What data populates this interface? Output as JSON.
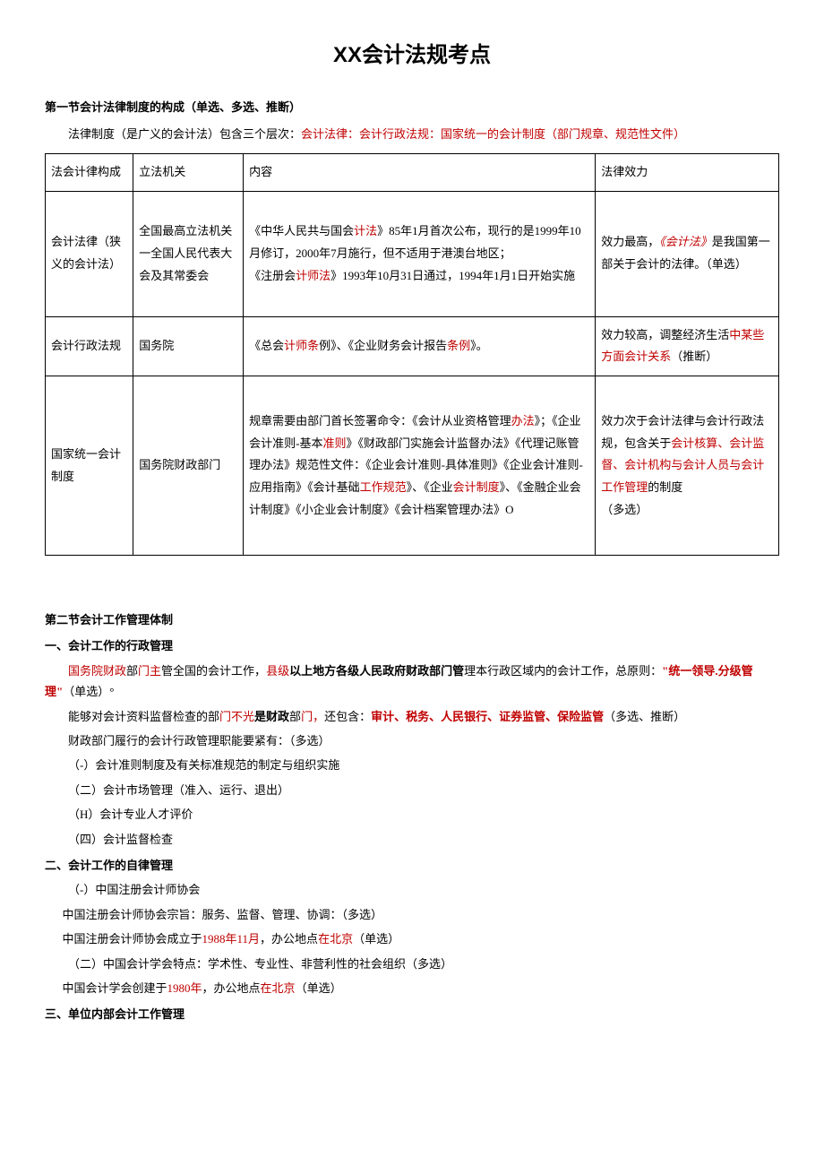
{
  "title": "XX会计法规考点",
  "section1": {
    "heading": "第一节会计法律制度的构成（单选、多选、推断）",
    "intro_pre": "法律制度（是广义的会计法）包含三个层次：",
    "intro_red": "会计法律：会计行政法规：国家统一的会计制度（部门规章、规范性文件）"
  },
  "table": {
    "header": {
      "c1": "法会计律构成",
      "c2": "立法机关",
      "c3": "内容",
      "c4": "法律效力"
    },
    "row1": {
      "c1": "会计法律（狭义的会计法）",
      "c2_a": "全国最高立法机关",
      "c2_b": "一全国人民代表大会及其常委会",
      "c3_a": "《中华人民共与国会",
      "c3_a_red": "计法",
      "c3_a2": "》85年1月首次公布，现行的是1999年10月修订，2000年7月施行，但不适用于港澳台地区；",
      "c3_b": "《注册会",
      "c3_b_red": "计师法",
      "c3_b2": "》1993年10月31日通过，1994年1月1日开始实施",
      "c4_a": "效力最高，",
      "c4_red": "《会计法》",
      "c4_b": "是我国第一部关于会计的法律。（单选）"
    },
    "row2": {
      "c1": "会计行政法规",
      "c2": "国务院",
      "c3_a": "《总会",
      "c3_a_red": "计师条",
      "c3_a2": "例》、《企业财务会计报告",
      "c3_a_red2": "条例",
      "c3_a3": "》。",
      "c4_a": "效力较高，调整经济生活",
      "c4_red": "中某些方面会计关系",
      "c4_b": "（推断）"
    },
    "row3": {
      "c1": "国家统一会计制度",
      "c2": "国务院财政部门",
      "c3_a": "规章需要由部门首长签署命令：《会计从业资格管理",
      "c3_red1": "办法",
      "c3_b": "》；《企业会计准则-基本",
      "c3_red2": "准则",
      "c3_c": "》《财政部门实施会计监督办法》《代理记账管理办法》规范性文件：《企业会计准则-具体准则》《企业会计准则-应用指南》《会计基础",
      "c3_red3": "工作规范",
      "c3_d": "》、《企业",
      "c3_red4": "会计制度",
      "c3_e": "》、《金融企业会计制度》《小企业会计制度》《会计档案管理办法》O",
      "c4_a": "效力次于会计法律与会计行政法规，包含关于",
      "c4_red": "会计核算、会计监督、会计机构与会计人员与会计工作管理",
      "c4_b": "的制度",
      "c4_c": "（多选）"
    }
  },
  "section2": {
    "heading": "第二节会计工作管理体制",
    "sub1": "一、会计工作的行政管理",
    "p1_red1": "国务院财政",
    "p1_a": "部",
    "p1_red2": "门主",
    "p1_b": "管全国的会计工作，",
    "p1_red3": "县级",
    "p1_bold": "以上地方各级人民政府财政部门管",
    "p1_c": "理本行政区域内的会计工作，总原则：",
    "p1_red4": "\"统一领导.分级管理\"",
    "p1_d": "（单选）°",
    "p2_a": "能够对会计资料监督检查的部",
    "p2_red1": "门不光",
    "p2_bold": "是财政",
    "p2_b": "部",
    "p2_red2": "门，",
    "p2_c": "还包含：",
    "p2_red3": "审计、税务、人民银行、证券监管、保险监管",
    "p2_d": "（多选、推断）",
    "p3": "财政部门履行的会计行政管理职能要紧有：（多选）",
    "p4": "（-）会计准则制度及有关标准规范的制定与组织实施",
    "p5": "（二）会计市场管理（准入、运行、退出）",
    "p6": "（H）会计专业人才评价",
    "p7": "（四）会计监督检查",
    "sub2": "二、会计工作的自律管理",
    "p8": "（-）中国注册会计师协会",
    "p9": "中国注册会计师协会宗旨：服务、监督、管理、协调：（多选）",
    "p10_a": "中国注册会计师协会成立于",
    "p10_red1": "1988年11月",
    "p10_b": "，办公地点",
    "p10_red2": "在北京",
    "p10_c": "（单选）",
    "p11": "（二）中国会计学会特点：学术性、专业性、非营利性的社会组织（多选）",
    "p12_a": "中国会计学会创建于",
    "p12_red1": "1980年",
    "p12_b": "，办公地点",
    "p12_red2": "在北京",
    "p12_c": "（单选）",
    "sub3": "三、单位内部会计工作管理"
  }
}
